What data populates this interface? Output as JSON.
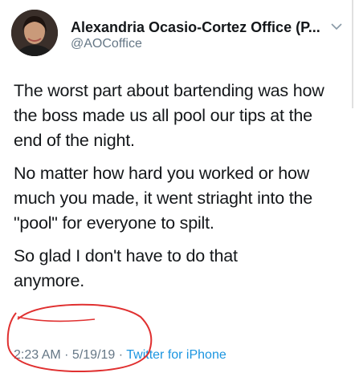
{
  "author": {
    "name": "Alexandria Ocasio-Cortez Office (P...",
    "handle": "@AOCoffice"
  },
  "tweet": {
    "paragraphs": [
      "The worst part about bartending was how the boss made us all pool our tips at the end of the night.",
      "No matter how hard you worked or how much you made, it went striaght into the \"pool\" for everyone to spilt."
    ],
    "last_paragraph_start": "So glad I don't have to do that",
    "last_paragraph_end": "anymore."
  },
  "meta": {
    "time": "2:23 AM",
    "separator": " · ",
    "date": "5/19/19",
    "separator2": " · ",
    "source": "Twitter for iPhone"
  },
  "colors": {
    "text": "#14171a",
    "secondary": "#657786",
    "link": "#1b95e0",
    "annotation": "#e03030"
  }
}
